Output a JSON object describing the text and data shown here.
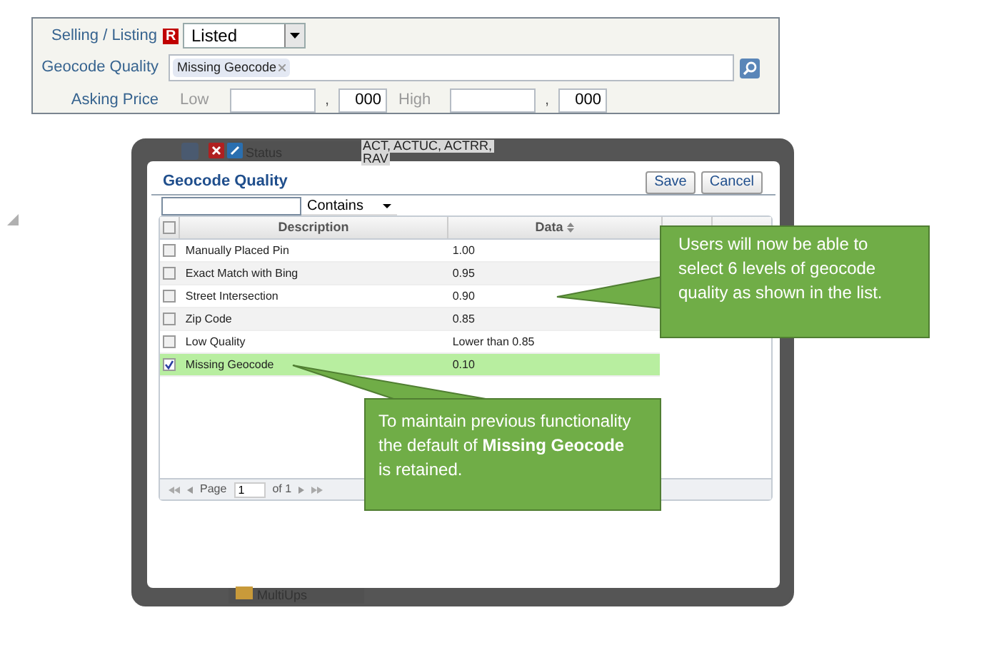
{
  "form": {
    "fields": [
      {
        "kind": "select",
        "label": "Selling / Listing",
        "badge": "R",
        "value": "Listed"
      },
      {
        "kind": "tags",
        "label": "Geocode Quality",
        "tags": [
          "Missing Geocode"
        ]
      },
      {
        "kind": "range",
        "label": "Asking Price",
        "low_label": "Low",
        "low_separator": ",",
        "low_thousands": "000",
        "high_label": "High",
        "high_separator": ",",
        "high_thousands": "000"
      }
    ]
  },
  "background": {
    "status_label": "Status",
    "status_value": [
      "ACT, ACTUC, ACTRR,",
      "RAV"
    ],
    "tree_item": "MultiUps"
  },
  "dialog": {
    "title": "Geocode Quality",
    "buttons": [
      "Save",
      "Cancel"
    ],
    "filter": {
      "operator": "Contains"
    },
    "columns": [
      "Description",
      "Data"
    ],
    "header_checked": false,
    "rows": [
      {
        "description": "Manually Placed Pin",
        "data": "1.00",
        "checked": false
      },
      {
        "description": "Exact Match with Bing",
        "data": "0.95",
        "checked": false
      },
      {
        "description": "Street Intersection",
        "data": "0.90",
        "checked": false
      },
      {
        "description": "Zip Code",
        "data": "0.85",
        "checked": false
      },
      {
        "description": "Low Quality",
        "data": "Lower than 0.85",
        "checked": false
      },
      {
        "description": "Missing Geocode",
        "data": "0.10",
        "checked": true
      }
    ],
    "pager": {
      "page_label": "Page",
      "page": "1",
      "of": "of 1"
    }
  },
  "callouts": [
    {
      "text": "Users will now be able to select 6 levels of geocode quality as shown in the list."
    },
    {
      "text": "To maintain previous functionality the default of **Missing Geocode** is retained."
    }
  ]
}
